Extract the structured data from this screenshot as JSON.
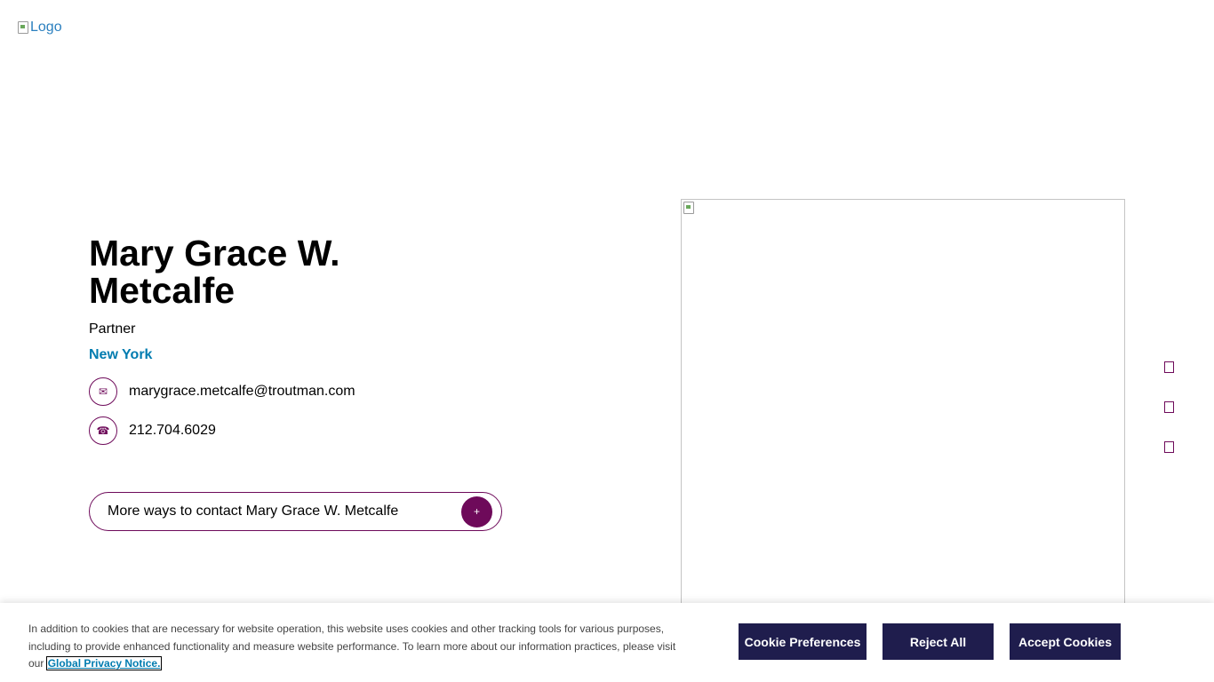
{
  "header": {
    "logo_alt": "Logo"
  },
  "profile": {
    "name": "Mary Grace W. Metcalfe",
    "title": "Partner",
    "office": "New York",
    "email": "marygrace.metcalfe@troutman.com",
    "phone": "212.704.6029",
    "more_contact_label": "More ways to contact Mary Grace W. Metcalfe"
  },
  "icons": {
    "email": "envelope-icon",
    "phone": "phone-icon",
    "more_contact": "plus-icon",
    "side": [
      "share-icon",
      "print-icon",
      "download-icon"
    ]
  },
  "cookie_banner": {
    "text": "In addition to cookies that are necessary for website operation, this website uses cookies and other tracking tools for various purposes, including to provide enhanced functionality and measure website performance. To learn more about our information practices, please visit our",
    "link_label": "Global Privacy Notice.",
    "buttons": {
      "preferences": "Cookie Preferences",
      "reject": "Reject All",
      "accept": "Accept Cookies"
    }
  },
  "colors": {
    "accent": "#6e0a5a",
    "link": "#007cb0",
    "button_bg": "#1f1d4d"
  }
}
